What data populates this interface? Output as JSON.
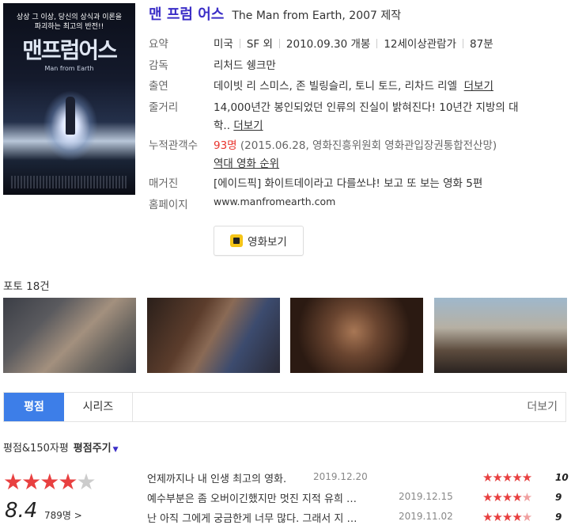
{
  "poster": {
    "tagline": "상상 그 이상, 당신의 상식과 이론을 파괴하는 최고의 반전!!",
    "title": "맨프럼어스",
    "subtitle": "Man from Earth"
  },
  "movie": {
    "title_kr": "맨 프럼 어스",
    "title_en": "The Man from Earth",
    "year_suffix": ", 2007 제작"
  },
  "info": {
    "summary_label": "요약",
    "summary_items": [
      "미국",
      "SF 외",
      "2010.09.30 개봉",
      "12세이상관람가",
      "87분"
    ],
    "director_label": "감독",
    "director": "리처드 쉥크만",
    "cast_label": "출연",
    "cast": "데이빗 리 스미스, 존 빌링슬리, 토니 토드, 리차드 리엘",
    "cast_more": "더보기",
    "plot_label": "줄거리",
    "plot_line1": "14,000년간 봉인되었던 인류의 진실이 밝혀진다! 10년간 지방의 대",
    "plot_line2": "학..",
    "plot_more": "더보기",
    "audience_label": "누적관객수",
    "audience_count": "93명",
    "audience_note": "(2015.06.28, 영화진흥위원회 영화관입장권통합전산망)",
    "audience_rank_link": "역대 영화 순위",
    "magazine_label": "매거진",
    "magazine_link": "[에이드픽] 화이트데이라고 다를쏘냐! 보고 또 보는 영화 5편",
    "homepage_label": "홈페이지",
    "homepage_url": "www.manfromearth.com"
  },
  "watch_button": "영화보기",
  "photos": {
    "header": "포토 18건"
  },
  "tabs": {
    "items": [
      "평점",
      "시리즈"
    ],
    "more": "더보기"
  },
  "rating": {
    "header": "평점&150자평",
    "give_label": "평점주기",
    "score": "8.4",
    "stars_filled": 4,
    "stars_total": 5,
    "votes": "789명 >",
    "reviews": [
      {
        "text": "언제까지나 내 인생 최고의 영화.",
        "date": "2019.12.20",
        "score": "10"
      },
      {
        "text": "예수부분은 좀 오버이긴했지만 멋진 지적 유희 …",
        "date": "2019.12.15",
        "score": "9"
      },
      {
        "text": "난 아직 그에게 궁금한게 너무 많다. 그래서 지 …",
        "date": "2019.11.02",
        "score": "9"
      }
    ]
  },
  "colors": {
    "title": "#3b2ec7",
    "accent_tab": "#3d7ee8",
    "star": "#e84040",
    "audience": "#e8332d",
    "homepage": "#2d8a3c"
  }
}
